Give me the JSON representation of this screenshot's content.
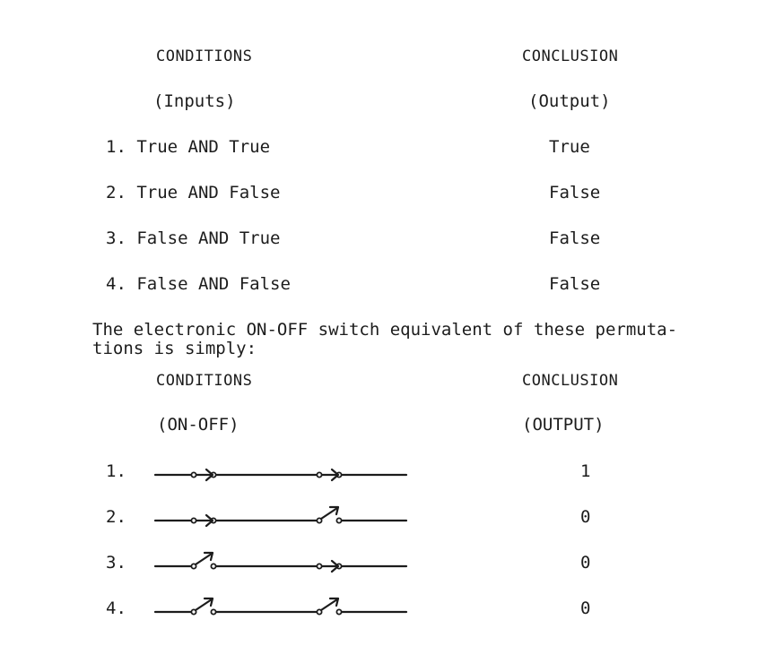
{
  "table1": {
    "header_left": "CONDITIONS",
    "header_right": "CONCLUSION",
    "sub_left": "(Inputs)",
    "sub_right": "(Output)",
    "rows": [
      {
        "condition": "1. True AND True",
        "conclusion": "True"
      },
      {
        "condition": "2. True AND False",
        "conclusion": "False"
      },
      {
        "condition": "3. False AND True",
        "conclusion": "False"
      },
      {
        "condition": "4. False AND False",
        "conclusion": "False"
      }
    ]
  },
  "paragraph": "The electronic ON-OFF switch equivalent of these permuta-\ntions is simply:",
  "table2": {
    "header_left": "CONDITIONS",
    "header_right": "CONCLUSION",
    "sub_left": "(ON-OFF)",
    "sub_right": "(OUTPUT)",
    "rows": [
      {
        "number": "1.",
        "switch_a": "closed",
        "switch_b": "closed",
        "output": "1"
      },
      {
        "number": "2.",
        "switch_a": "closed",
        "switch_b": "open",
        "output": "0"
      },
      {
        "number": "3.",
        "switch_a": "open",
        "switch_b": "closed",
        "output": "0"
      },
      {
        "number": "4.",
        "switch_a": "open",
        "switch_b": "open",
        "output": "0"
      }
    ]
  }
}
